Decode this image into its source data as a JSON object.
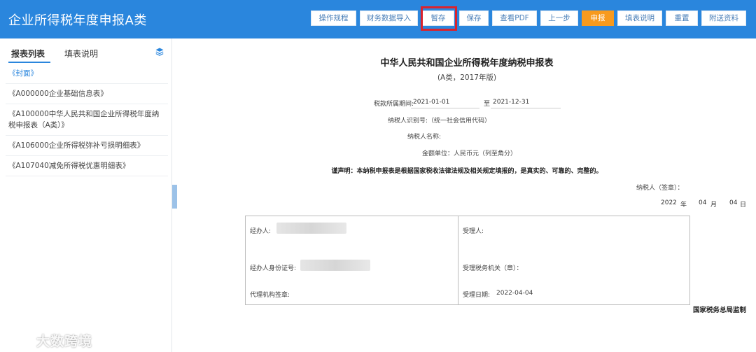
{
  "app": {
    "title": "企业所得税年度申报A类"
  },
  "toolbar": {
    "buttons": [
      "操作规程",
      "财务数据导入",
      "暂存",
      "保存",
      "查看PDF",
      "上一步",
      "申报",
      "填表说明",
      "重置",
      "附送资料"
    ]
  },
  "sidebar": {
    "tabs": [
      "报表列表",
      "填表说明"
    ],
    "items": [
      "《封面》",
      "《A000000企业基础信息表》",
      "《A100000中华人民共和国企业所得税年度纳税申报表（A类）》",
      "《A106000企业所得税弥补亏损明细表》",
      "《A107040减免所得税优惠明细表》"
    ]
  },
  "document": {
    "title": "中华人民共和国企业所得税年度纳税申报表",
    "subtitle": "(A类，2017年版)",
    "period_label": "税款所属期间:",
    "period_start": "2021-01-01",
    "period_to": "至",
    "period_end": "2021-12-31",
    "taxpayer_id_label": "纳税人识别号:（统一社会信用代码）",
    "taxpayer_name_label": "纳税人名称:",
    "unit_label": "金额单位：人民币元（列至角分）",
    "declaration": "谨声明：本纳税申报表是根据国家税收法律法规及相关规定填报的，是真实的、可靠的、完整的。",
    "sign_label": "纳税人（签章）：",
    "date_year": "2022",
    "date_year_unit": "年",
    "date_month": "04",
    "date_month_unit": "月",
    "date_day": "04",
    "date_day_unit": "日",
    "handler_label": "经办人:",
    "handler_id_label": "经办人身份证号:",
    "agent_seal_label": "代理机构签章:",
    "receiver_label": "受理人:",
    "tax_office_label": "受理税务机关（章）：",
    "accept_date_label": "受理日期:",
    "accept_date": "2022-04-04",
    "footer": "国家税务总局监制"
  },
  "watermark": {
    "text": "大数跨境"
  },
  "colors": {
    "header": "#2a86dd",
    "primary_button": "#f79a1e",
    "highlight": "#d9232e"
  }
}
